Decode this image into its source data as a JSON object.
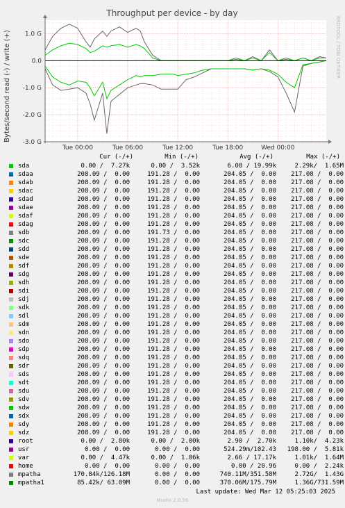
{
  "chart_data": {
    "type": "line",
    "title": "Throughput per device - by day",
    "ylabel": "Bytes/second read (-) / write (+)",
    "side_text": "RRDTOOL / TOBI OETIKER",
    "yticks": [
      "1.0 G",
      "0.0",
      "-1.0 G",
      "-2.0 G",
      "-3.0 G"
    ],
    "ylim": [
      -3.0,
      1.5
    ],
    "y_unit": "G",
    "xticks": [
      "Tue 00:00",
      "Tue 06:00",
      "Tue 12:00",
      "Tue 18:00",
      "Wed 00:00"
    ],
    "x_hours_span": [
      -3.9,
      29.8
    ],
    "grid": true,
    "series": [
      {
        "name": "sda",
        "color": "#00cc00",
        "x": [
          -3.9,
          -3.0,
          -2.0,
          -1.0,
          0.0,
          1.0,
          1.5,
          2.0,
          3.0,
          3.5,
          4.0,
          5.0,
          6.0,
          7.0,
          7.5,
          8.0,
          9.0,
          10.0,
          11.0,
          11.5,
          12.0,
          13.0,
          14.0,
          15.0,
          16.0,
          17.0,
          18.0,
          19.0,
          20.0,
          21.0,
          22.0,
          23.0,
          24.0,
          25.0,
          26.0,
          27.0,
          28.0,
          29.0,
          29.8
        ],
        "write": [
          0.2,
          0.4,
          0.55,
          0.65,
          0.6,
          0.45,
          0.3,
          0.35,
          0.55,
          0.5,
          0.55,
          0.6,
          0.5,
          0.6,
          0.55,
          0.45,
          0.1,
          0.0,
          0.0,
          0.0,
          0.0,
          0.0,
          0.0,
          0.0,
          0.0,
          0.0,
          0.0,
          0.05,
          0.0,
          0.1,
          0.0,
          0.3,
          0.0,
          0.05,
          0.0,
          0.1,
          0.0,
          0.1,
          0.1
        ],
        "read": [
          -0.2,
          -0.6,
          -0.8,
          -0.9,
          -0.75,
          -0.8,
          -1.0,
          -1.3,
          -0.8,
          -1.4,
          -1.1,
          -0.9,
          -0.7,
          -0.55,
          -0.6,
          -0.55,
          -0.55,
          -0.5,
          -0.5,
          -0.5,
          -0.55,
          -0.5,
          -0.45,
          -0.35,
          -0.3,
          -0.3,
          -0.3,
          -0.3,
          -0.3,
          -0.35,
          -0.3,
          -0.35,
          -0.5,
          -0.8,
          -1.0,
          -0.15,
          -0.1,
          -0.05,
          0.0
        ]
      },
      {
        "name": "mpatha",
        "color": "#666666",
        "x": [
          -3.9,
          -3.0,
          -2.0,
          -1.0,
          0.0,
          1.0,
          1.5,
          2.0,
          3.0,
          3.5,
          4.0,
          5.0,
          6.0,
          7.0,
          7.5,
          8.0,
          9.0,
          10.0,
          11.0,
          12.0,
          13.0,
          14.0,
          15.0,
          16.0,
          17.0,
          18.0,
          19.0,
          20.0,
          21.0,
          22.0,
          23.0,
          24.0,
          25.0,
          26.0,
          27.0,
          28.0,
          29.0,
          29.8
        ],
        "write": [
          0.4,
          0.9,
          1.2,
          1.35,
          1.2,
          0.7,
          0.5,
          0.8,
          1.1,
          0.9,
          1.1,
          1.25,
          1.05,
          1.2,
          1.1,
          0.7,
          0.2,
          0.0,
          0.0,
          0.0,
          0.0,
          0.0,
          0.0,
          0.0,
          0.0,
          0.0,
          0.1,
          0.0,
          0.15,
          0.0,
          0.4,
          0.0,
          0.1,
          0.0,
          0.1,
          0.0,
          0.15,
          0.1
        ],
        "read": [
          -0.3,
          -0.9,
          -1.1,
          -1.05,
          -1.0,
          -1.2,
          -1.6,
          -2.2,
          -1.2,
          -2.7,
          -1.5,
          -1.25,
          -1.0,
          -0.9,
          -0.85,
          -0.85,
          -0.9,
          -1.05,
          -1.05,
          -1.05,
          -0.7,
          -0.6,
          -0.45,
          -0.3,
          -0.3,
          -0.3,
          -0.3,
          -0.3,
          -0.35,
          -0.3,
          -0.4,
          -0.6,
          -1.2,
          -1.9,
          -0.2,
          -0.1,
          -0.05,
          0.0
        ]
      }
    ],
    "legend_headers": [
      "Cur (-/+)",
      "Min (-/+)",
      "Avg (-/+)",
      "Max (-/+)"
    ],
    "legend": [
      {
        "name": "sda",
        "color": "#00cc00",
        "cur": "0.00 /  7.27k",
        "min": "0.00 /  3.52k",
        "avg": "6.08 / 19.99k",
        "max": "2.29k/  1.65M"
      },
      {
        "name": "sdaa",
        "color": "#0066b3",
        "cur": "208.09 /  0.00",
        "min": "191.28 /  0.00",
        "avg": "204.05 /  0.00",
        "max": "217.08 /  0.00"
      },
      {
        "name": "sdab",
        "color": "#ff8000",
        "cur": "208.09 /  0.00",
        "min": "191.28 /  0.00",
        "avg": "204.05 /  0.00",
        "max": "217.08 /  0.00"
      },
      {
        "name": "sdac",
        "color": "#ffcc00",
        "cur": "208.09 /  0.00",
        "min": "191.28 /  0.00",
        "avg": "204.05 /  0.00",
        "max": "217.08 /  0.00"
      },
      {
        "name": "sdad",
        "color": "#330099",
        "cur": "208.09 /  0.00",
        "min": "191.28 /  0.00",
        "avg": "204.05 /  0.00",
        "max": "217.08 /  0.00"
      },
      {
        "name": "sdae",
        "color": "#990099",
        "cur": "208.09 /  0.00",
        "min": "191.28 /  0.00",
        "avg": "204.05 /  0.00",
        "max": "217.08 /  0.00"
      },
      {
        "name": "sdaf",
        "color": "#ccff00",
        "cur": "208.09 /  0.00",
        "min": "191.28 /  0.00",
        "avg": "204.05 /  0.00",
        "max": "217.08 /  0.00"
      },
      {
        "name": "sdag",
        "color": "#ff0000",
        "cur": "208.09 /  0.00",
        "min": "191.28 /  0.00",
        "avg": "204.05 /  0.00",
        "max": "217.08 /  0.00"
      },
      {
        "name": "sdb",
        "color": "#808080",
        "cur": "208.09 /  0.00",
        "min": "191.73 /  0.00",
        "avg": "204.05 /  0.00",
        "max": "217.08 /  0.00"
      },
      {
        "name": "sdc",
        "color": "#008f00",
        "cur": "208.09 /  0.00",
        "min": "191.28 /  0.00",
        "avg": "204.05 /  0.00",
        "max": "217.08 /  0.00"
      },
      {
        "name": "sdd",
        "color": "#00487d",
        "cur": "208.09 /  0.00",
        "min": "191.28 /  0.00",
        "avg": "204.05 /  0.00",
        "max": "217.08 /  0.00"
      },
      {
        "name": "sde",
        "color": "#b35a00",
        "cur": "208.09 /  0.00",
        "min": "191.28 /  0.00",
        "avg": "204.05 /  0.00",
        "max": "217.08 /  0.00"
      },
      {
        "name": "sdf",
        "color": "#b38f00",
        "cur": "208.09 /  0.00",
        "min": "191.28 /  0.00",
        "avg": "204.05 /  0.00",
        "max": "217.08 /  0.00"
      },
      {
        "name": "sdg",
        "color": "#6b006b",
        "cur": "208.09 /  0.00",
        "min": "191.28 /  0.00",
        "avg": "204.05 /  0.00",
        "max": "217.08 /  0.00"
      },
      {
        "name": "sdh",
        "color": "#8fb300",
        "cur": "208.09 /  0.00",
        "min": "191.28 /  0.00",
        "avg": "204.05 /  0.00",
        "max": "217.08 /  0.00"
      },
      {
        "name": "sdi",
        "color": "#b30000",
        "cur": "208.09 /  0.00",
        "min": "191.28 /  0.00",
        "avg": "204.05 /  0.00",
        "max": "217.08 /  0.00"
      },
      {
        "name": "sdj",
        "color": "#bebebe",
        "cur": "208.09 /  0.00",
        "min": "191.28 /  0.00",
        "avg": "204.05 /  0.00",
        "max": "217.08 /  0.00"
      },
      {
        "name": "sdk",
        "color": "#80ff80",
        "cur": "208.09 /  0.00",
        "min": "191.28 /  0.00",
        "avg": "204.05 /  0.00",
        "max": "217.08 /  0.00"
      },
      {
        "name": "sdl",
        "color": "#80c9ff",
        "cur": "208.09 /  0.00",
        "min": "191.28 /  0.00",
        "avg": "204.05 /  0.00",
        "max": "217.08 /  0.00"
      },
      {
        "name": "sdm",
        "color": "#ffc080",
        "cur": "208.09 /  0.00",
        "min": "191.28 /  0.00",
        "avg": "204.05 /  0.00",
        "max": "217.08 /  0.00"
      },
      {
        "name": "sdn",
        "color": "#ffe680",
        "cur": "208.09 /  0.00",
        "min": "191.28 /  0.00",
        "avg": "204.05 /  0.00",
        "max": "217.08 /  0.00"
      },
      {
        "name": "sdo",
        "color": "#aa80ff",
        "cur": "208.09 /  0.00",
        "min": "191.28 /  0.00",
        "avg": "204.05 /  0.00",
        "max": "217.08 /  0.00"
      },
      {
        "name": "sdp",
        "color": "#ee00cc",
        "cur": "208.09 /  0.00",
        "min": "191.28 /  0.00",
        "avg": "204.05 /  0.00",
        "max": "217.08 /  0.00"
      },
      {
        "name": "sdq",
        "color": "#ff8080",
        "cur": "208.09 /  0.00",
        "min": "191.28 /  0.00",
        "avg": "204.05 /  0.00",
        "max": "217.08 /  0.00"
      },
      {
        "name": "sdr",
        "color": "#666600",
        "cur": "208.09 /  0.00",
        "min": "191.28 /  0.00",
        "avg": "204.05 /  0.00",
        "max": "217.08 /  0.00"
      },
      {
        "name": "sds",
        "color": "#ffbfff",
        "cur": "208.09 /  0.00",
        "min": "191.28 /  0.00",
        "avg": "204.05 /  0.00",
        "max": "217.08 /  0.00"
      },
      {
        "name": "sdt",
        "color": "#00ffcc",
        "cur": "208.09 /  0.00",
        "min": "191.28 /  0.00",
        "avg": "204.05 /  0.00",
        "max": "217.08 /  0.00"
      },
      {
        "name": "sdu",
        "color": "#cc6699",
        "cur": "208.09 /  0.00",
        "min": "191.28 /  0.00",
        "avg": "204.05 /  0.00",
        "max": "217.08 /  0.00"
      },
      {
        "name": "sdv",
        "color": "#999900",
        "cur": "208.09 /  0.00",
        "min": "191.28 /  0.00",
        "avg": "204.05 /  0.00",
        "max": "217.08 /  0.00"
      },
      {
        "name": "sdw",
        "color": "#00cc00",
        "cur": "208.09 /  0.00",
        "min": "191.28 /  0.00",
        "avg": "204.05 /  0.00",
        "max": "217.08 /  0.00"
      },
      {
        "name": "sdx",
        "color": "#0066b3",
        "cur": "208.09 /  0.00",
        "min": "191.28 /  0.00",
        "avg": "204.05 /  0.00",
        "max": "217.08 /  0.00"
      },
      {
        "name": "sdy",
        "color": "#ff8000",
        "cur": "208.09 /  0.00",
        "min": "191.28 /  0.00",
        "avg": "204.05 /  0.00",
        "max": "217.08 /  0.00"
      },
      {
        "name": "sdz",
        "color": "#ffcc00",
        "cur": "208.09 /  0.00",
        "min": "191.28 /  0.00",
        "avg": "204.05 /  0.00",
        "max": "217.08 /  0.00"
      },
      {
        "name": "root",
        "color": "#330099",
        "cur": "0.00 /  2.80k",
        "min": "0.00 /  2.00k",
        "avg": "2.90 /  2.70k",
        "max": "1.10k/  4.23k"
      },
      {
        "name": "usr",
        "color": "#990099",
        "cur": "0.00 /  0.00",
        "min": "0.00 /  0.00",
        "avg": "524.29m/102.43",
        "max": "198.00 /  5.81k"
      },
      {
        "name": "var",
        "color": "#ccff00",
        "cur": "0.00 /  4.47k",
        "min": "0.00 /  1.06k",
        "avg": "2.66 / 17.17k",
        "max": "1.01k/  1.64M"
      },
      {
        "name": "home",
        "color": "#ff0000",
        "cur": "0.00 /  0.00",
        "min": "0.00 /  0.00",
        "avg": "0.00 / 20.96",
        "max": "0.00 /  2.24k"
      },
      {
        "name": "mpatha",
        "color": "#808080",
        "cur": "170.84k/126.18M",
        "min": "0.00 /  0.00",
        "avg": "740.11M/351.58M",
        "max": "2.72G/  1.43G"
      },
      {
        "name": "mpatha1",
        "color": "#008f00",
        "cur": "85.42k/ 63.09M",
        "min": "0.00 /  0.00",
        "avg": "370.06M/175.79M",
        "max": "1.36G/731.59M"
      }
    ]
  },
  "footer": {
    "last_update": "Last update: Wed Mar 12 05:25:03 2025",
    "munin": "Munin 2.0.56"
  }
}
